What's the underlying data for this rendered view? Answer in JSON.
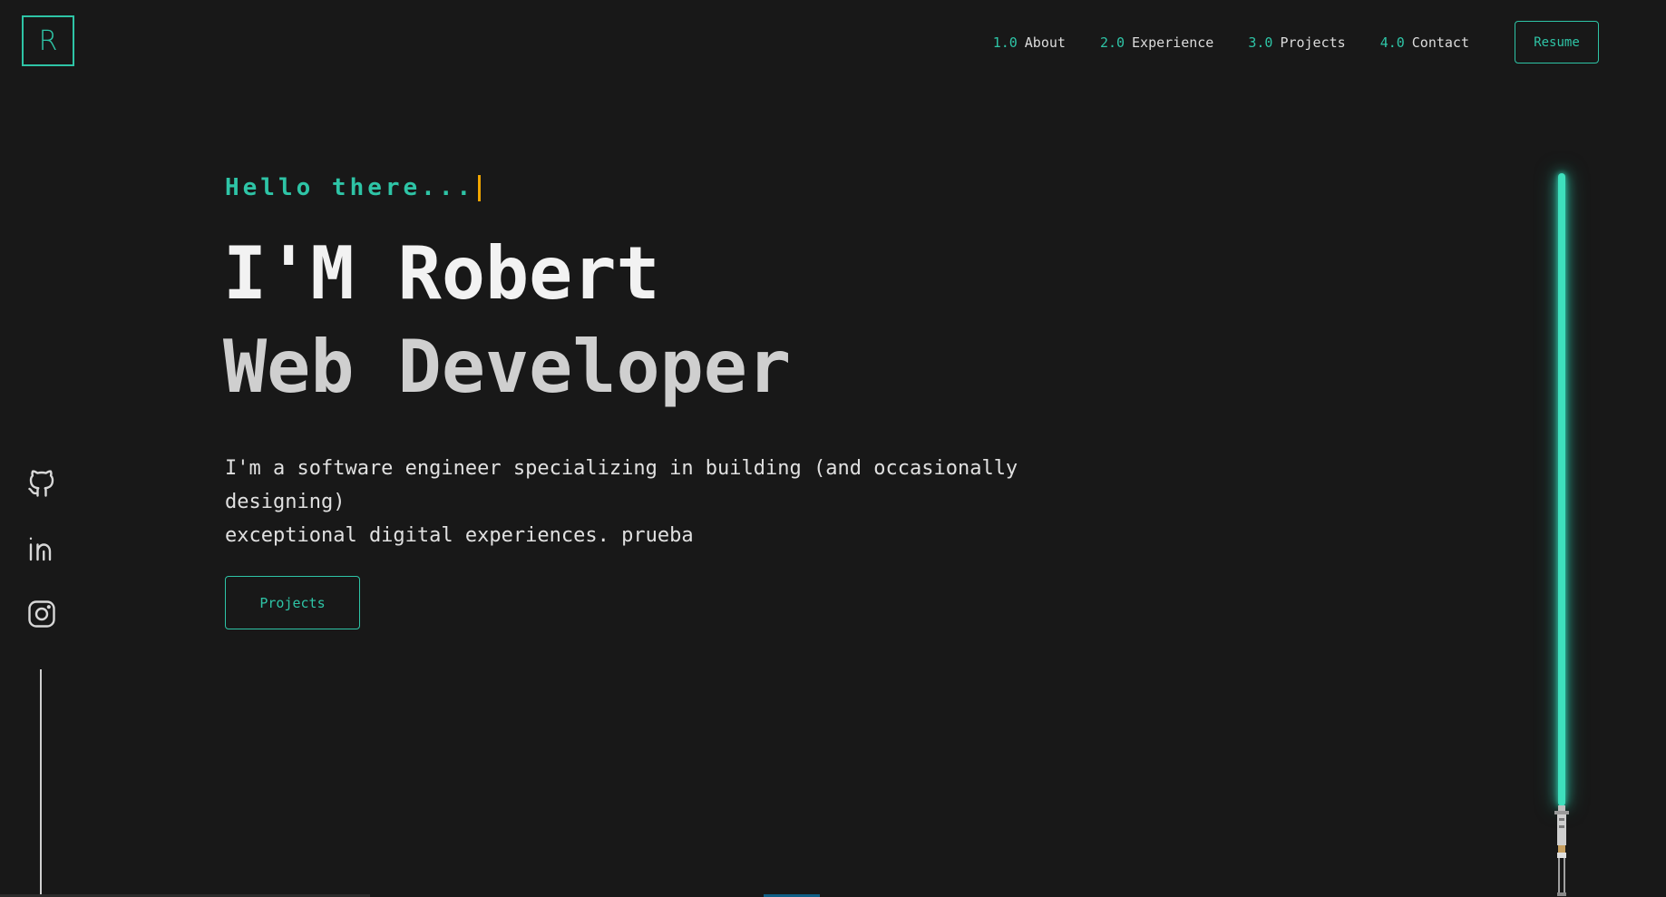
{
  "header": {
    "logo_letter": "R",
    "nav": [
      {
        "num": "1.0",
        "label": "About"
      },
      {
        "num": "2.0",
        "label": "Experience"
      },
      {
        "num": "3.0",
        "label": "Projects"
      },
      {
        "num": "4.0",
        "label": "Contact"
      }
    ],
    "resume_label": "Resume"
  },
  "hero": {
    "greeting": "Hello there...",
    "name": "I'M Robert",
    "role": "Web Developer",
    "intro_line1": "I'm a software engineer specializing in building (and occasionally designing)",
    "intro_line2": "exceptional digital experiences. prueba",
    "projects_button": "Projects"
  },
  "social": {
    "icons": [
      "github-icon",
      "linkedin-icon",
      "instagram-icon"
    ]
  },
  "colors": {
    "accent": "#2ec4a6",
    "cursor": "#f0a500",
    "background": "#181818"
  }
}
